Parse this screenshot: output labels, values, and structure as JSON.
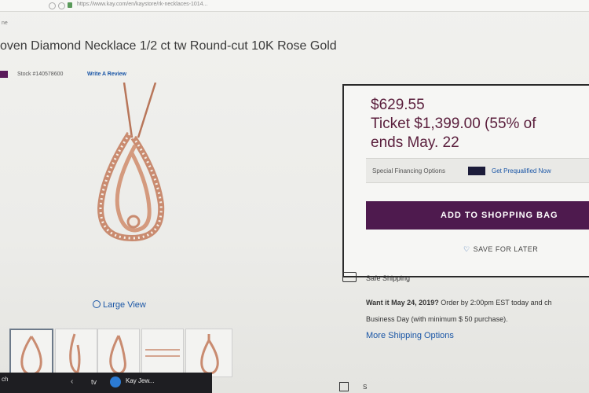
{
  "browser": {
    "url": "https://www.kay.com/en/kaystore/rk-necklaces-1014..."
  },
  "menu_fragment": "ne",
  "product": {
    "title": "oven Diamond Necklace 1/2 ct tw Round-cut 10K Rose Gold",
    "stock": "Stock #140578600",
    "write_review": "Write A Review",
    "large_view": "Large View"
  },
  "pricing": {
    "price": "$629.55",
    "ticket": "Ticket  $1,399.00 (55% of",
    "ends": "ends May. 22",
    "financing_label": "Special Financing Options",
    "prequalify_link": "Get Prequalified Now",
    "add_to_bag": "ADD TO SHOPPING BAG",
    "save_for_later": "SAVE FOR LATER"
  },
  "shipping": {
    "title": "Safe Shipping",
    "want_it_bold": "Want it May 24, 2019?",
    "want_it_rest": " Order by 2:00pm EST today and ch",
    "line2": "Business Day (with minimum $ 50 purchase).",
    "more_options": "More Shipping Options"
  },
  "bottom_text": "S",
  "taskbar": {
    "left_text": "ch",
    "tv_label": "tv",
    "tab_label": "Kay Jew..."
  },
  "colors": {
    "brand_purple": "#4e1a4e",
    "price_color": "#5a1e3c",
    "link_blue": "#1a56a6"
  }
}
